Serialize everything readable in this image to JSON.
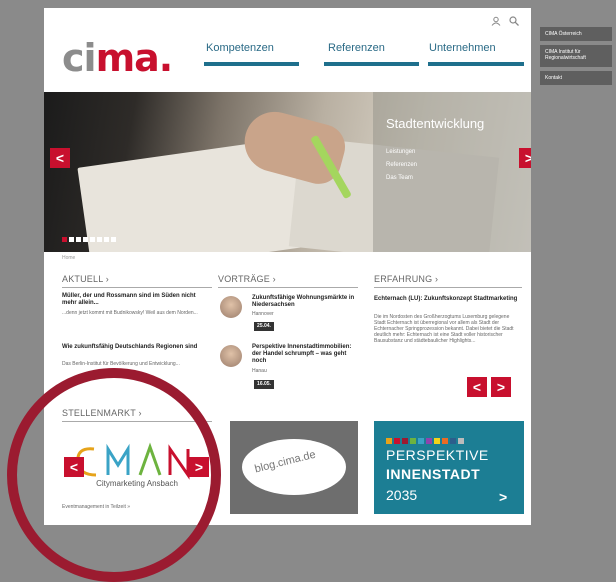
{
  "side_menu": [
    "CIMA Österreich",
    "CIMA Institut für Regionalwirtschaft",
    "Kontakt"
  ],
  "header": {
    "logo_prefix": "ci",
    "logo_suffix": "ma.",
    "nav": [
      "Kompetenzen",
      "Referenzen",
      "Unternehmen"
    ]
  },
  "hero": {
    "title": "Stadtentwicklung",
    "links": [
      "Leistungen",
      "Referenzen",
      "Das Team"
    ],
    "prev": "<",
    "next": ">"
  },
  "breadcrumb": "Home",
  "aktuell": {
    "heading": "AKTUELL ›",
    "item1_title": "Müller, der und Rossmann sind im Süden nicht mehr allein...",
    "item1_text": "...denn jetzt kommt mit Budnikowsky! Weil aus dem Norden...",
    "item2_title": "Wie zukunftsfähig Deutschlands Regionen sind",
    "item2_text": "Das Berlin-Institut für Bevölkerung und Entwicklung..."
  },
  "vortraege": {
    "heading": "VORTRÄGE ›",
    "items": [
      {
        "title": "Zukunftsfähige Wohnungsmärkte in Niedersachsen",
        "place": "Hannover",
        "date": "25.04."
      },
      {
        "title": "Perspektive Innenstadtimmobilien: der Handel schrumpft – was geht noch",
        "place": "Hanau",
        "date": "16.05."
      }
    ]
  },
  "erfahrung": {
    "heading": "ERFAHRUNG ›",
    "title": "Echternach (LU): Zukunftskonzept Stadtmarketing",
    "text": "Die im Nordosten des Großherzogtums Luxemburg gelegene Stadt Echternach ist überregional vor allem als Stadt der Echternacher Springprozession bekannt. Dabei bietet die Stadt deutlich mehr: Echternach ist eine Stadt voller historischer Bausubstanz und städtebaulicher Highlights..."
  },
  "stellenmarkt": {
    "heading": "STELLENMARKT ›",
    "logo_text": "CMAN",
    "logo_sub": "Citymarketing Ansbach",
    "caption": "Eventmanagement in Teilzeit »"
  },
  "blog": {
    "label": "blog.cima.de"
  },
  "perspektive": {
    "line1": "PERSPEKTIVE",
    "line2": "INNENSTADT",
    "line3": "2035",
    "arrow": ">"
  },
  "colors": {
    "brand_red": "#c8102e",
    "teal": "#1c7e94",
    "circle": "#9b1b30"
  }
}
